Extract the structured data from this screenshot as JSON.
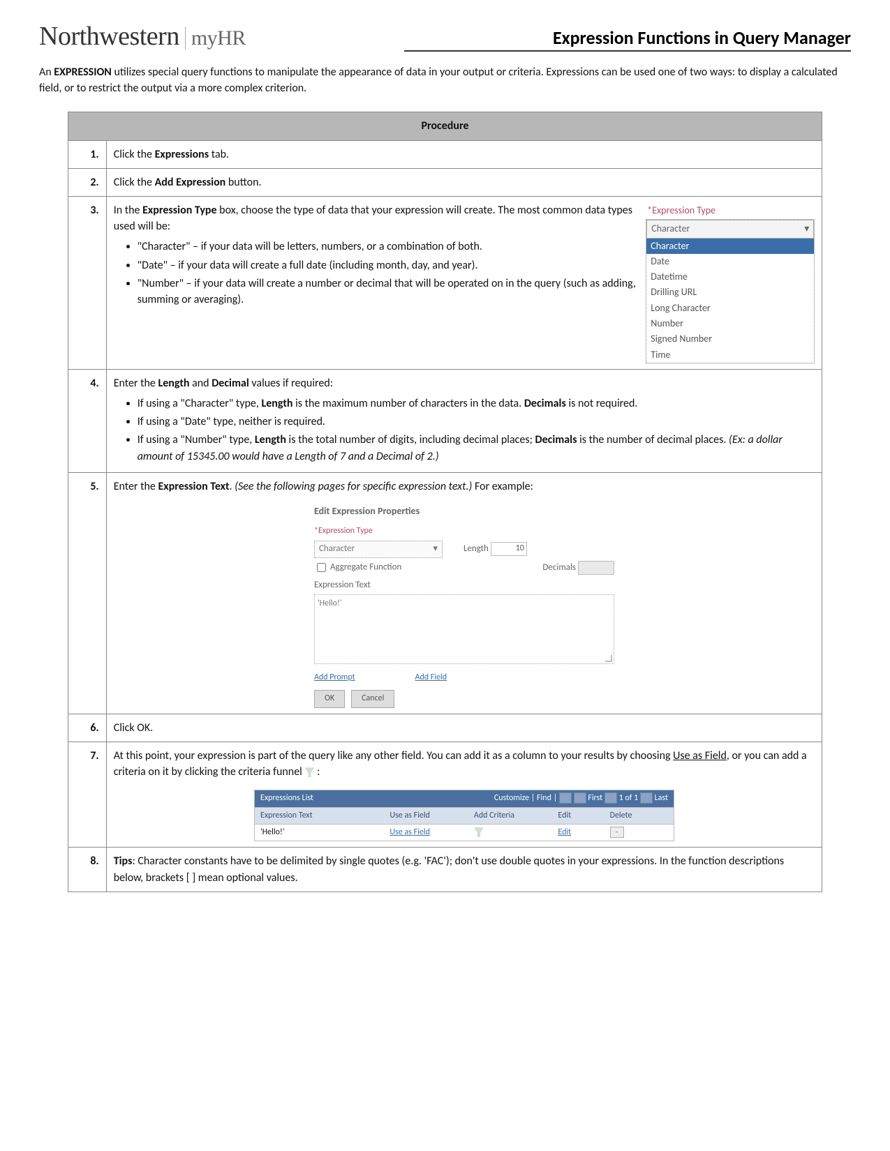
{
  "brand": {
    "name": "Northwestern",
    "sub": "myHR"
  },
  "title": "Expression Functions in Query Manager",
  "intro_pre": "An ",
  "intro_bold": "EXPRESSION",
  "intro_post": " utilizes special query functions to manipulate the appearance of data in your output or criteria. Expressions can be used one of two ways: to display a calculated field, or to restrict the output via a more complex criterion.",
  "procedure_label": "Procedure",
  "s1": {
    "n": "1.",
    "pre": "Click the ",
    "b": "Expressions",
    "post": " tab."
  },
  "s2": {
    "n": "2.",
    "pre": "Click the ",
    "b": "Add Expression",
    "post": " button."
  },
  "s3": {
    "n": "3.",
    "pre": "In the ",
    "b": "Expression Type",
    "post": " box, choose the type of data that your expression will create. The most common data types used will be:",
    "b1": "\"Character\" – if your data will be letters, numbers, or a combination of both.",
    "b2": "\"Date\" – if your data will create a full date (including month, day, and year).",
    "b3": "\"Number\" – if your data will create a number or decimal that will be operated on in the query (such as adding, summing or averaging).",
    "dd": {
      "label": "*Expression Type",
      "field": "Character",
      "sel": "Character",
      "opts": [
        "Date",
        "Datetime",
        "Drilling URL",
        "Long Character",
        "Number",
        "Signed Number",
        "Time"
      ]
    }
  },
  "s4": {
    "n": "4.",
    "pre": "Enter the ",
    "b1": "Length",
    "mid": " and ",
    "b2": "Decimal",
    "post": " values if required:",
    "li1a": "If using a \"Character\" type, ",
    "li1b": "Length",
    "li1c": " is the maximum number of characters in the data. ",
    "li1d": "Decimals",
    "li1e": " is not required.",
    "li2": "If using a \"Date\" type, neither is required.",
    "li3a": "If using a \"Number\" type, ",
    "li3b": "Length",
    "li3c": " is the total number of digits, including decimal places; ",
    "li3d": "Decimals",
    "li3e": " is the number of decimal places. ",
    "li3f": "(Ex: a dollar amount of 15345.00 would have a Length of 7 and a Decimal of 2.)"
  },
  "s5": {
    "n": "5.",
    "pre": "Enter the ",
    "b": "Expression Text",
    "mid": ". ",
    "i": "(See the following pages for specific expression text.)",
    "post": " For example:",
    "panel": {
      "title": "Edit Expression Properties",
      "etype_label": "*Expression Type",
      "etype_val": "Character",
      "len_label": "Length",
      "len_val": "10",
      "dec_label": "Decimals",
      "agg": "Aggregate Function",
      "et_label": "Expression Text",
      "et_val": "'Hello!'",
      "add_prompt": "Add Prompt",
      "add_field": "Add Field",
      "ok": "OK",
      "cancel": "Cancel"
    }
  },
  "s6": {
    "n": "6.",
    "text": "Click OK."
  },
  "s7": {
    "n": "7.",
    "pre": "At this point, your expression is part of the query like any other field. You can add it as a column to your results by choosing ",
    "u": "Use as Field",
    "post": ", or you can add a criteria on it by clicking the criteria funnel ",
    "grid": {
      "title": "Expressions List",
      "right": "Customize | Find |",
      "right2": "First",
      "right3": "1 of 1",
      "right4": "Last",
      "cols": {
        "c1": "Expression Text",
        "c2": "Use as Field",
        "c3": "Add Criteria",
        "c4": "Edit",
        "c5": "Delete"
      },
      "row": {
        "c1": "'Hello!'",
        "c2": "Use as Field",
        "c4": "Edit"
      }
    }
  },
  "s8": {
    "n": "8.",
    "b": "Tips",
    "post": ": Character constants have to be delimited by single quotes (e.g. 'FAC'); don't use double quotes in your expressions. In the function descriptions below, brackets [ ] mean optional values."
  }
}
